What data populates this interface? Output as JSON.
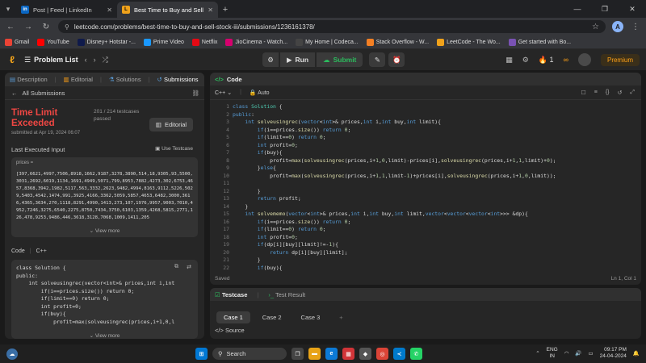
{
  "browser": {
    "tabs": [
      {
        "title": "Post | Feed | LinkedIn",
        "icon": "linkedin-icon",
        "active": false
      },
      {
        "title": "Best Time to Buy and Sell Stoc",
        "icon": "leetcode-icon",
        "active": true
      }
    ],
    "url": "leetcode.com/problems/best-time-to-buy-and-sell-stock-iii/submissions/1236161378/",
    "profile_initial": "A",
    "bookmarks": [
      "Gmail",
      "YouTube",
      "Disney+ Hotstar -...",
      "Prime Video",
      "Netflix",
      "JioCinema - Watch...",
      "My Home | Codeca...",
      "Stack Overflow - W...",
      "LeetCode - The Wo...",
      "Get started with Bo..."
    ]
  },
  "header": {
    "problem_list": "Problem List",
    "run": "Run",
    "submit": "Submit",
    "streak": "1",
    "premium": "Premium"
  },
  "left": {
    "tabs": [
      "Description",
      "Editorial",
      "Solutions",
      "Submissions"
    ],
    "all_submissions": "All Submissions",
    "status": "Time Limit Exceeded",
    "testcases": "201 / 214 testcases passed",
    "editorial_button": "Editorial",
    "submitted_at": "submitted at Apr 19, 2024 06:07",
    "last_input_label": "Last Executed Input",
    "use_testcase": "Use Testcase",
    "input_name": "prices =",
    "input_value": "[397,6621,4997,7506,8918,1662,9187,3278,3890,514,18,9305,93,5500,3031,2692,6019,1134,1691,4949,5071,799,8953,7882,4273,302,6753,4657,8368,3942,1982,5117,563,3332,2623,9482,4994,8163,9112,5226,5029,5403,4542,1474,991,3925,4166,3362,5059,5857,4653,6482,3000,3616,4365,3634,270,1118,8291,4990,1413,273,107,1976,9957,9003,7010,4952,7246,3275,6540,2275,8750,7434,3750,6103,1359,4268,5815,2771,126,478,9253,9486,446,3618,3128,7068,1009,1411,205",
    "view_more": "View more",
    "code_label": "Code",
    "code_lang": "C++",
    "code_preview": "class Solution {\npublic:\n    int solveusingrec(vector<int>& prices,int i,int\n        if(i==prices.size()) return 0;\n        if(limit==0) return 0;\n        int profit=0;\n        if(buy){\n            profit=max(solveusingrec(prices,i+1,0,l",
    "code_view_more": "View more"
  },
  "editor": {
    "title": "Code",
    "language": "C++",
    "mode": "Auto",
    "lines": [
      "class Solution {",
      "public:",
      "    int solveusingrec(vector<int>& prices,int i,int buy,int limit){",
      "        if(i==prices.size()) return 0;",
      "        if(limit==0) return 0;",
      "        int profit=0;",
      "        if(buy){",
      "            profit=max(solveusingrec(prices,i+1,0,limit)-prices[i],solveusingrec(prices,i+1,1,limit)+0);",
      "        }else{",
      "            profit=max(solveusingrec(prices,i+1,1,limit-1)+prices[i],solveusingrec(prices,i+1,0,limit));",
      "",
      "        }",
      "        return profit;",
      "    }",
      "    int solvememo(vector<int>& prices,int i,int buy,int limit,vector<vector<vector<int>>> &dp){",
      "        if(i==prices.size()) return 0;",
      "        if(limit==0) return 0;",
      "        int profit=0;",
      "        if(dp[i][buy][limit]!=-1){",
      "            return dp[i][buy][limit];",
      "        }",
      "        if(buy){"
    ],
    "saved": "Saved",
    "cursor": "Ln 1, Col 1"
  },
  "testpanel": {
    "tabs": [
      "Testcase",
      "Test Result"
    ],
    "cases": [
      "Case 1",
      "Case 2",
      "Case 3"
    ],
    "source": "Source"
  },
  "taskbar": {
    "search": "Search",
    "lang": "ENG",
    "region": "IN",
    "time": "09:17 PM",
    "date": "24-04-2024"
  }
}
